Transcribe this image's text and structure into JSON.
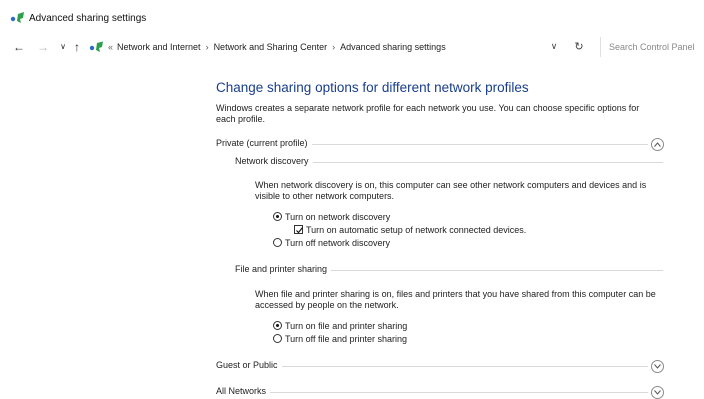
{
  "window": {
    "title": "Advanced sharing settings",
    "icon": "network-sharing-icon"
  },
  "nav": {
    "back_icon": "back-arrow-icon",
    "forward_icon": "forward-arrow-icon",
    "recent_icon": "chevron-down-icon",
    "up_icon": "up-arrow-icon",
    "breadcrumb_lead": "«",
    "breadcrumbs": [
      "Network and Internet",
      "Network and Sharing Center",
      "Advanced sharing settings"
    ],
    "search_placeholder": "Search Control Panel"
  },
  "main": {
    "heading": "Change sharing options for different network profiles",
    "intro": "Windows creates a separate network profile for each network you use. You can choose specific options for each profile.",
    "private_profile": {
      "label": "Private (current profile)",
      "expanded": true,
      "network_discovery": {
        "label": "Network discovery",
        "description": "When network discovery is on, this computer can see other network computers and devices and is visible to other network computers.",
        "options": {
          "turn_on": "Turn on network discovery",
          "auto_setup": "Turn on automatic setup of network connected devices.",
          "turn_off": "Turn off network discovery"
        },
        "selected": "turn_on",
        "auto_setup_checked": true
      },
      "file_printer_sharing": {
        "label": "File and printer sharing",
        "description": "When file and printer sharing is on, files and printers that you have shared from this computer can be accessed by people on the network.",
        "options": {
          "turn_on": "Turn on file and printer sharing",
          "turn_off": "Turn off file and printer sharing"
        },
        "selected": "turn_on"
      }
    },
    "guest_public": {
      "label": "Guest or Public",
      "expanded": false
    },
    "all_networks": {
      "label": "All Networks",
      "expanded": false
    }
  },
  "colors": {
    "heading": "#1a3e8c",
    "accent_green": "#2e9e4f",
    "accent_blue": "#2b6cc4"
  }
}
